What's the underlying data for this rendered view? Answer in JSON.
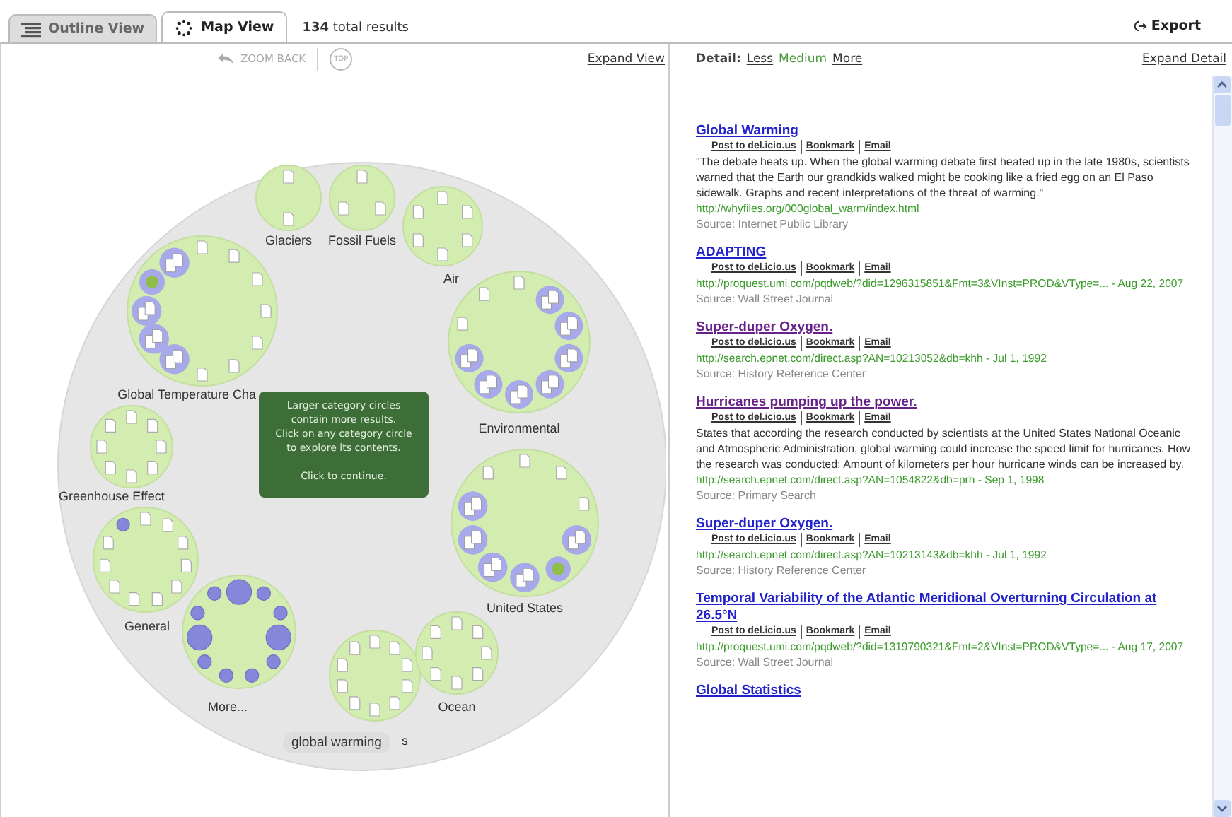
{
  "tabs": [
    {
      "label": "Outline View",
      "selected": false
    },
    {
      "label": "Map View",
      "selected": true
    }
  ],
  "total_results": "**134** total results",
  "export": "Export",
  "map_toolbar": {
    "zoom_back": {
      "label": "ZOOM BACK",
      "disabled": true
    },
    "top": {
      "label": "TOP",
      "disabled": true
    },
    "expand": "Expand View"
  },
  "map": {
    "categories": [
      {
        "label": "Glaciers",
        "items": [
          {
            "kind": "doc"
          },
          {
            "kind": "doc"
          }
        ]
      },
      {
        "label": "Fossil Fuels",
        "items": [
          {
            "kind": "doc"
          },
          {
            "kind": "doc"
          },
          {
            "kind": "doc"
          }
        ]
      },
      {
        "label": "Air",
        "items": [
          {
            "kind": "doc"
          },
          {
            "kind": "doc"
          },
          {
            "kind": "doc"
          },
          {
            "kind": "doc"
          },
          {
            "kind": "doc"
          },
          {
            "kind": "doc"
          }
        ]
      },
      {
        "label": "Global Temperature Cha",
        "items": [
          {
            "kind": "doc"
          },
          {
            "kind": "doc"
          },
          {
            "kind": "doc"
          },
          {
            "kind": "doc"
          },
          {
            "kind": "doc"
          },
          {
            "kind": "doc"
          },
          {
            "kind": "doc"
          },
          {
            "kind": "group"
          },
          {
            "kind": "group"
          },
          {
            "kind": "group"
          },
          {
            "kind": "green-group"
          },
          {
            "kind": "group"
          }
        ]
      },
      {
        "label": "Environmental",
        "items": [
          {
            "kind": "doc"
          },
          {
            "kind": "group"
          },
          {
            "kind": "group"
          },
          {
            "kind": "group"
          },
          {
            "kind": "group"
          },
          {
            "kind": "group"
          },
          {
            "kind": "group"
          },
          {
            "kind": "group"
          },
          {
            "kind": "doc"
          },
          {
            "kind": "doc"
          }
        ]
      },
      {
        "label": "Greenhouse Effect",
        "items": [
          {
            "kind": "doc"
          },
          {
            "kind": "doc"
          },
          {
            "kind": "doc"
          },
          {
            "kind": "doc"
          },
          {
            "kind": "doc"
          },
          {
            "kind": "doc"
          },
          {
            "kind": "doc"
          },
          {
            "kind": "doc"
          }
        ]
      },
      {
        "label": "United States",
        "items": [
          {
            "kind": "doc"
          },
          {
            "kind": "doc"
          },
          {
            "kind": "doc"
          },
          {
            "kind": "group"
          },
          {
            "kind": "green-group"
          },
          {
            "kind": "group"
          },
          {
            "kind": "group"
          },
          {
            "kind": "group"
          },
          {
            "kind": "group"
          },
          {
            "kind": "doc"
          }
        ]
      },
      {
        "label": "General",
        "items": [
          {
            "kind": "doc"
          },
          {
            "kind": "doc"
          },
          {
            "kind": "doc"
          },
          {
            "kind": "doc"
          },
          {
            "kind": "doc"
          },
          {
            "kind": "doc"
          },
          {
            "kind": "doc"
          },
          {
            "kind": "doc"
          },
          {
            "kind": "doc"
          },
          {
            "kind": "doc"
          },
          {
            "kind": "ball"
          }
        ]
      },
      {
        "label": "More...",
        "items": [
          {
            "kind": "large-ball"
          },
          {
            "kind": "ball"
          },
          {
            "kind": "ball"
          },
          {
            "kind": "large-ball"
          },
          {
            "kind": "ball"
          },
          {
            "kind": "ball"
          },
          {
            "kind": "ball"
          },
          {
            "kind": "ball"
          },
          {
            "kind": "large-ball"
          },
          {
            "kind": "ball"
          },
          {
            "kind": "ball"
          }
        ]
      },
      {
        "label": "s",
        "items": [
          {
            "kind": "doc"
          },
          {
            "kind": "doc"
          },
          {
            "kind": "doc"
          },
          {
            "kind": "doc"
          },
          {
            "kind": "doc"
          },
          {
            "kind": "doc"
          },
          {
            "kind": "doc"
          },
          {
            "kind": "doc"
          },
          {
            "kind": "doc"
          },
          {
            "kind": "doc"
          }
        ]
      },
      {
        "label": "Ocean",
        "items": [
          {
            "kind": "doc"
          },
          {
            "kind": "doc"
          },
          {
            "kind": "doc"
          },
          {
            "kind": "doc"
          },
          {
            "kind": "doc"
          },
          {
            "kind": "doc"
          },
          {
            "kind": "doc"
          },
          {
            "kind": "doc"
          }
        ]
      }
    ],
    "tip": {
      "message": [
        "Larger category circles",
        "contain more results.",
        "Click on any category circle",
        "to explore its contents."
      ],
      "action": "Click to continue."
    },
    "root": "global warming"
  },
  "detail": {
    "label": "Detail:",
    "options": [
      {
        "label": "Less",
        "selected": false
      },
      {
        "label": "Medium",
        "selected": true
      },
      {
        "label": "More",
        "selected": false
      }
    ],
    "expand": "Expand Detail"
  },
  "results": [
    {
      "title": "Global Warming",
      "visited": false,
      "actions": [
        "Post to del.icio.us",
        "Bookmark",
        "Email"
      ],
      "description": "\"The debate heats up. When the global warming debate first heated up in the late 1980s, scientists warned that the Earth our grandkids walked might be cooking like a fried egg on an El Paso sidewalk. Graphs and recent interpretations of the threat of warming.\"",
      "url": "http://whyfiles.org/000global_warm/index.html",
      "source": "Source: Internet Public Library"
    },
    {
      "title": "ADAPTING",
      "visited": false,
      "actions": [
        "Post to del.icio.us",
        "Bookmark",
        "Email"
      ],
      "url": "http://proquest.umi.com/pqdweb/?did=1296315851&Fmt=3&VInst=PROD&VType=... - Aug 22, 2007",
      "source": "Source: Wall Street Journal"
    },
    {
      "title": "Super-duper Oxygen.",
      "visited": true,
      "actions": [
        "Post to del.icio.us",
        "Bookmark",
        "Email"
      ],
      "url": "http://search.epnet.com/direct.asp?AN=10213052&db=khh - Jul 1, 1992",
      "source": "Source: History Reference Center"
    },
    {
      "title": "Hurricanes pumping up the power.",
      "visited": true,
      "actions": [
        "Post to del.icio.us",
        "Bookmark",
        "Email"
      ],
      "description": "States that according the research conducted by scientists at the United States National Oceanic and Atmospheric Administration, global warming could increase the speed limit for hurricanes. How the research was conducted; Amount of kilometers per hour hurricane winds can be increased by.",
      "url": "http://search.epnet.com/direct.asp?AN=1054822&db=prh - Sep 1, 1998",
      "source": "Source: Primary Search"
    },
    {
      "title": "Super-duper Oxygen.",
      "visited": false,
      "actions": [
        "Post to del.icio.us",
        "Bookmark",
        "Email"
      ],
      "url": "http://search.epnet.com/direct.asp?AN=10213143&db=khh - Jul 1, 1992",
      "source": "Source: History Reference Center"
    },
    {
      "title": "Temporal Variability of the Atlantic Meridional Overturning Circulation at 26.5°N",
      "visited": false,
      "actions": [
        "Post to del.icio.us",
        "Bookmark",
        "Email"
      ],
      "url": "http://proquest.umi.com/pqdweb/?did=1319790321&Fmt=2&VInst=PROD&VType=... - Aug 17, 2007",
      "source": "Source: Wall Street Journal"
    },
    {
      "title": "Global Statistics",
      "visited": false
    }
  ]
}
